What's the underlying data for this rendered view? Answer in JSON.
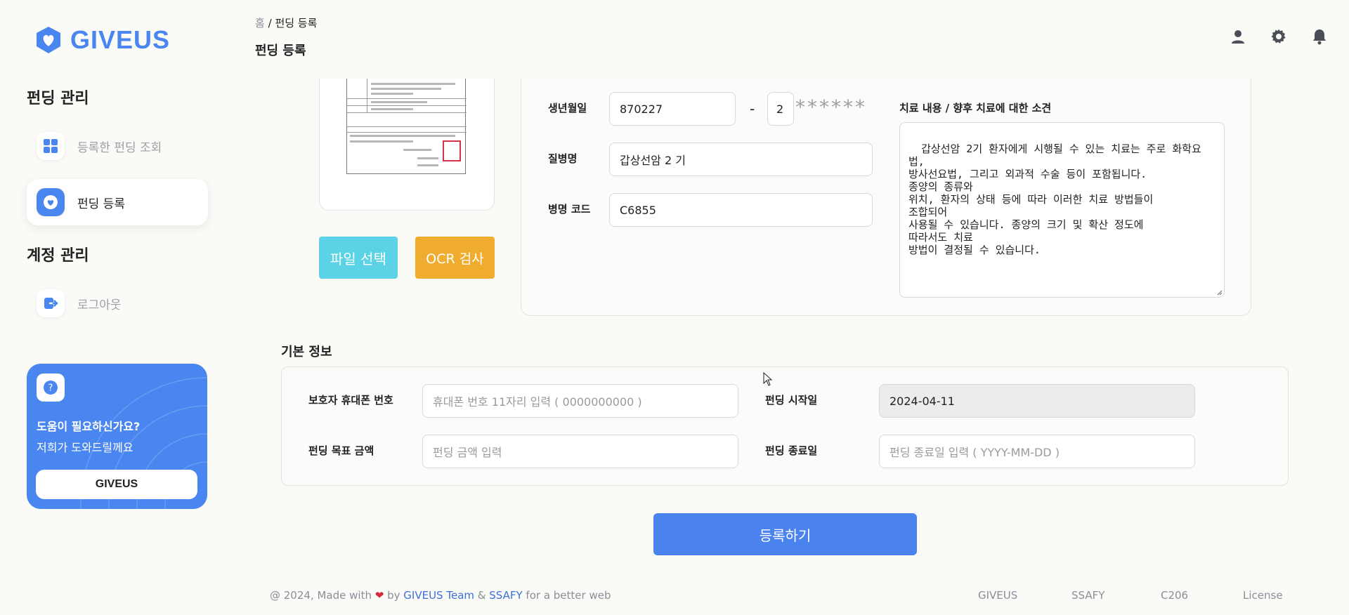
{
  "brand": {
    "name": "GIVEUS",
    "color": "#4a86f0"
  },
  "sidebar": {
    "section1": "펀딩 관리",
    "items": [
      {
        "label": "등록한 펀딩 조회",
        "icon": "grid-icon"
      },
      {
        "label": "펀딩 등록",
        "icon": "heart-icon"
      }
    ],
    "section2": "계정 관리",
    "logout": {
      "label": "로그아웃",
      "icon": "logout-icon"
    },
    "help": {
      "title": "도움이 필요하신가요?",
      "subtitle": "저희가 도와드릴께요",
      "button": "GIVEUS"
    }
  },
  "header": {
    "breadcrumb_home": "홈",
    "breadcrumb_sep": "/",
    "breadcrumb_current": "펀딩 등록",
    "title": "펀딩 등록",
    "icons": [
      "user-icon",
      "gear-icon",
      "bell-icon"
    ]
  },
  "document": {
    "file_button": "파일 선택",
    "ocr_button": "OCR 검사"
  },
  "patient": {
    "birth_label": "생년월일",
    "birth_value": "870227",
    "dash": "-",
    "gender_digit": "2",
    "mask": "******",
    "disease_label": "질병명",
    "disease_value": "갑상선암 2 기",
    "code_label": "병명 코드",
    "code_value": "C6855",
    "opinion_label": "치료 내용 / 향후 치료에 대한 소견",
    "opinion_value": "갑상선암 2기 환자에게 시행될 수 있는 치료는 주로 화학요법,\n방사선요법, 그리고 외과적 수술 등이 포함됩니다.\n종양의 종류와\n위치, 환자의 상태 등에 따라 이러한 치료 방법들이\n조합되어\n사용될 수 있습니다. 종양의 크기 및 확산 정도에\n따라서도 치료\n방법이 결정될 수 있습니다."
  },
  "basic_info": {
    "title": "기본 정보",
    "phone_label": "보호자 휴대폰 번호",
    "phone_placeholder": "휴대폰 번호 11자리 입력 ( 0000000000 )",
    "goal_label": "펀딩 목표 금액",
    "goal_placeholder": "펀딩 금액 입력",
    "start_label": "펀딩 시작일",
    "start_value": "2024-04-11",
    "end_label": "펀딩 종료일",
    "end_placeholder": "펀딩 종료일 입력 ( YYYY-MM-DD )"
  },
  "submit_button": "등록하기",
  "footer": {
    "prefix": "@ 2024, Made with",
    "by": "by",
    "team": "GIVEUS Team",
    "amp": "&",
    "ssafy": "SSAFY",
    "suffix": "for a better web",
    "links": [
      "GIVEUS",
      "SSAFY",
      "C206",
      "License"
    ]
  }
}
